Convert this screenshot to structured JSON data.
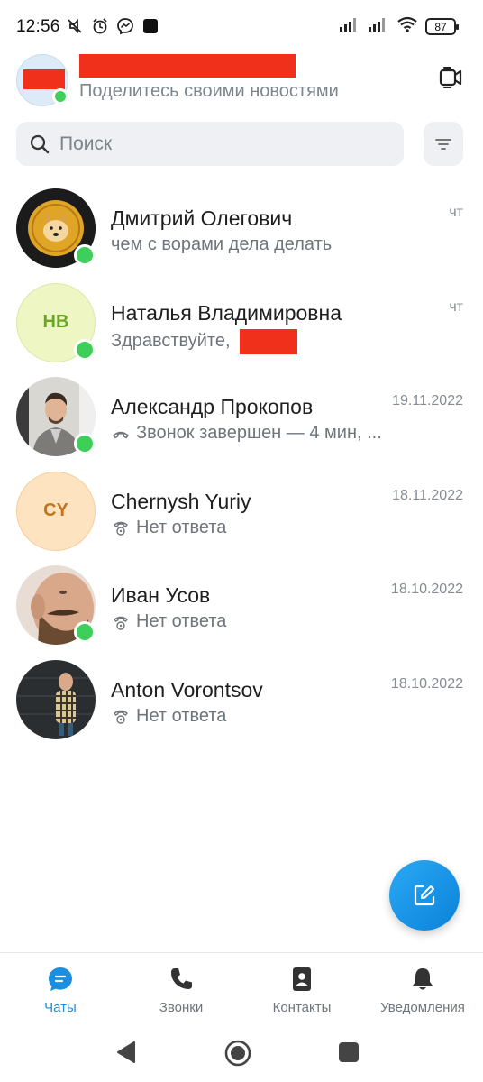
{
  "status_bar": {
    "time": "12:56",
    "battery": "87",
    "icons": [
      "mute-icon",
      "alarm-icon",
      "messenger-icon",
      "app-icon",
      "signal-icon",
      "signal-icon",
      "wifi-icon",
      "battery-icon"
    ]
  },
  "header": {
    "status_text": "Поделитесь своими новостями",
    "video_button_icon": "video-call-icon"
  },
  "search": {
    "placeholder": "Поиск"
  },
  "chats": [
    {
      "name": "Дмитрий Олегович",
      "preview": "чем с ворами дела делать",
      "date": "чт",
      "online": true,
      "avatar": "photo"
    },
    {
      "name": "Наталья Владимировна",
      "preview": "Здравствуйте,",
      "date": "чт",
      "online": true,
      "avatar_initials": "НВ",
      "avatar_color": "#eef6c4",
      "initials_color": "#6aa526"
    },
    {
      "name": "Александр Прокопов",
      "preview": "Звонок завершен — 4 мин, ...",
      "date": "19.11.2022",
      "online": true,
      "avatar": "photo"
    },
    {
      "name": "Chernysh Yuriy",
      "preview": "Нет ответа",
      "date": "18.11.2022",
      "online": false,
      "avatar_initials": "CY",
      "avatar_color": "#fde3c0",
      "initials_color": "#c0751c"
    },
    {
      "name": "Иван Усов",
      "preview": "Нет ответа",
      "date": "18.10.2022",
      "online": true,
      "avatar": "photo"
    },
    {
      "name": "Anton Vorontsov",
      "preview": "Нет ответа",
      "date": "18.10.2022",
      "online": false,
      "avatar": "photo"
    }
  ],
  "bottom_nav": [
    {
      "label": "Чаты",
      "icon": "chat-icon",
      "active": true
    },
    {
      "label": "Звонки",
      "icon": "phone-icon",
      "active": false
    },
    {
      "label": "Контакты",
      "icon": "contacts-icon",
      "active": false
    },
    {
      "label": "Уведомления",
      "icon": "bell-icon",
      "active": false
    }
  ],
  "colors": {
    "accent": "#1a8ee0",
    "online": "#3ecf5a",
    "redaction": "#f0301a"
  }
}
